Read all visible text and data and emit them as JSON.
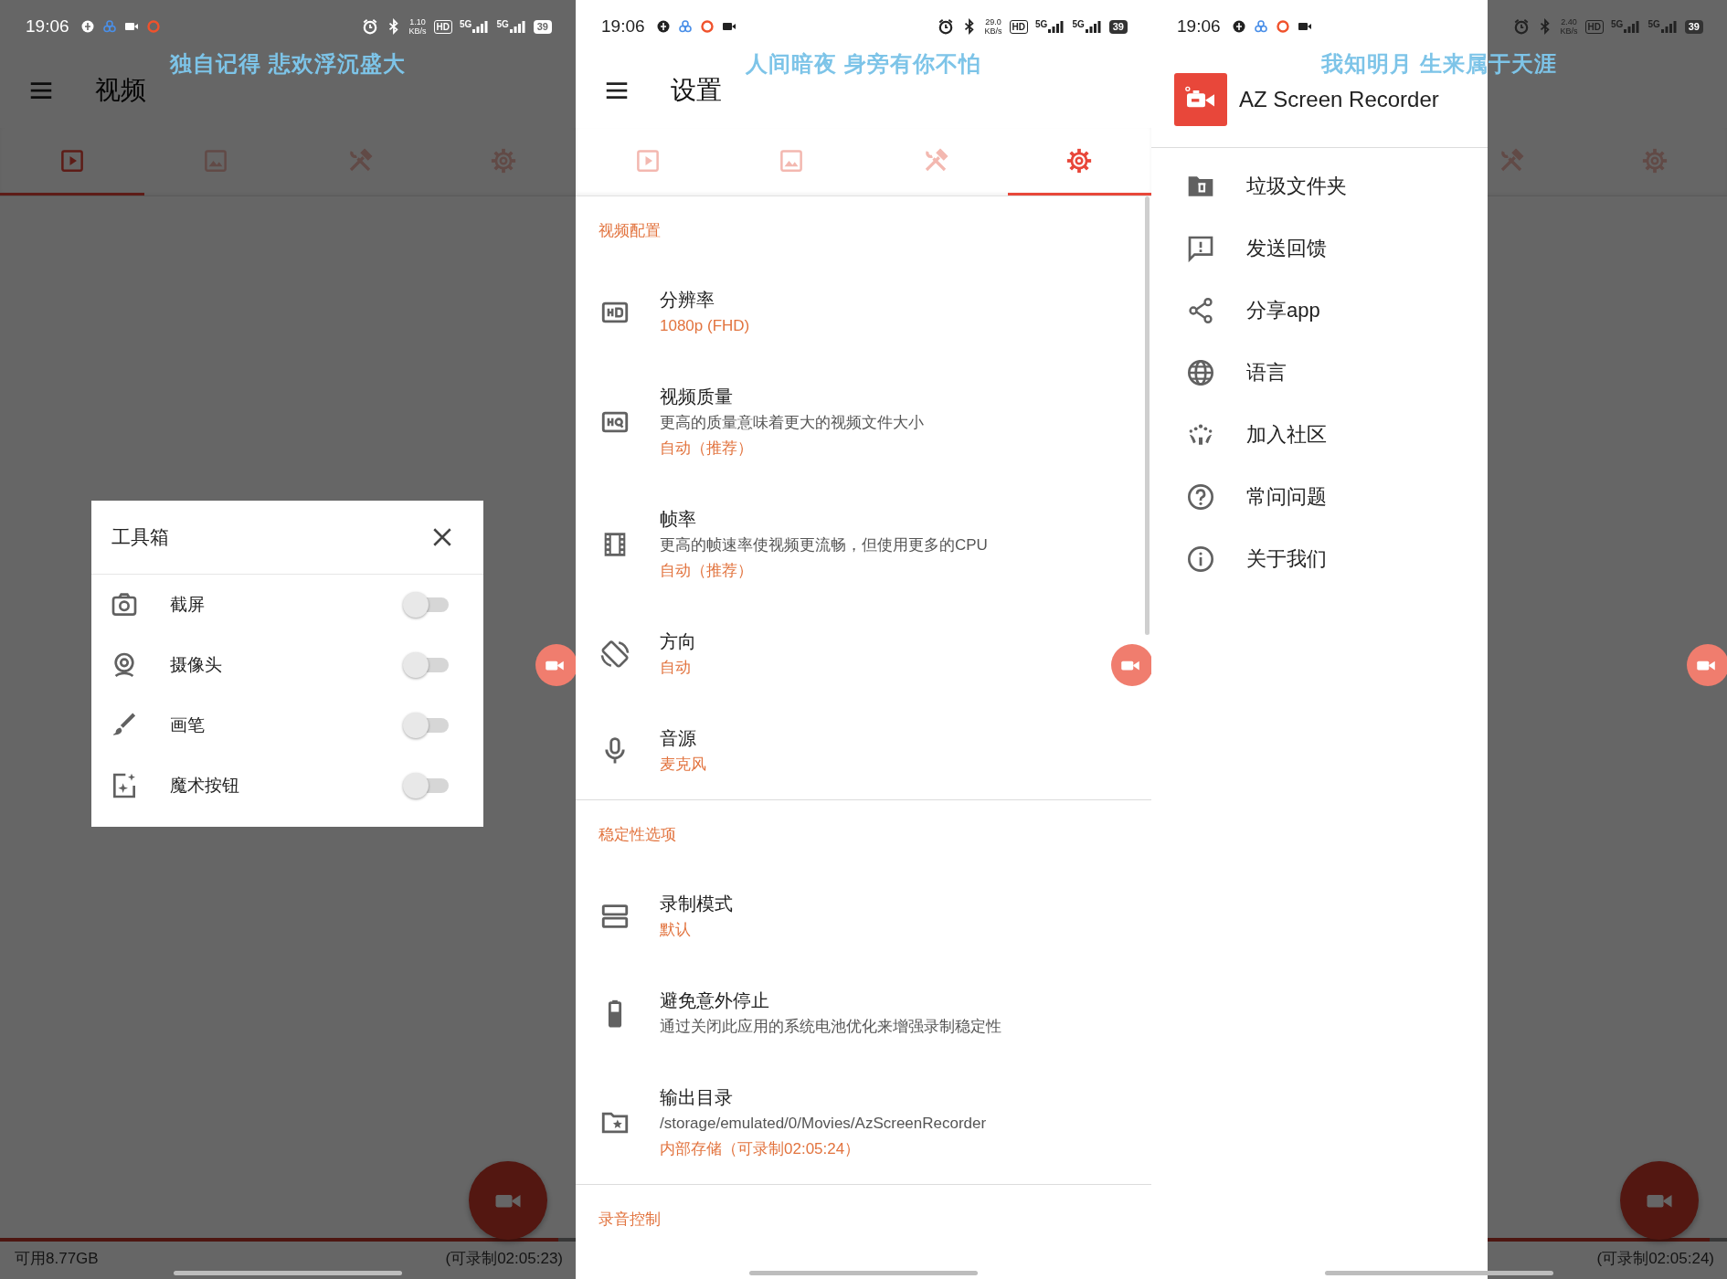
{
  "panels": [
    {
      "status_bar": {
        "time": "19:06",
        "notifications": [
          {
            "kind": "shield"
          },
          {
            "kind": "triad"
          },
          {
            "kind": "video"
          },
          {
            "kind": "record"
          }
        ],
        "speed": "1.10",
        "speed_unit": "KB/s",
        "hd": "HD",
        "networks": [
          "5G",
          "5G"
        ],
        "battery": "39",
        "light": true
      },
      "lyric": "独自记得 悲欢浮沉盛大",
      "dimmed": true,
      "record_button": true,
      "toolbar": {
        "title": "视频"
      },
      "tabs": [
        {
          "kind": "video",
          "selected": true
        },
        {
          "kind": "image",
          "selected": false
        },
        {
          "kind": "tools",
          "selected": false
        },
        {
          "kind": "settings",
          "selected": false
        }
      ],
      "dialog": {
        "title": "工具箱",
        "items": [
          {
            "kind": "camera",
            "label": "截屏",
            "on": false
          },
          {
            "kind": "webcam",
            "label": "摄像头",
            "on": false
          },
          {
            "kind": "brush",
            "label": "画笔",
            "on": false
          },
          {
            "kind": "magic",
            "label": "魔术按钮",
            "on": false
          }
        ]
      },
      "footer": {
        "storage": "可用8.77GB",
        "remaining": "(可录制02:05:23)",
        "level": 0.97
      }
    },
    {
      "status_bar": {
        "time": "19:06",
        "notifications": [
          {
            "kind": "shield"
          },
          {
            "kind": "triad"
          },
          {
            "kind": "record"
          },
          {
            "kind": "video"
          }
        ],
        "speed": "29.0",
        "speed_unit": "KB/s",
        "hd": "HD",
        "networks": [
          "5G",
          "5G"
        ],
        "battery": "39",
        "light": false
      },
      "lyric": "人间暗夜 身旁有你不怕",
      "dimmed": false,
      "toolbar": {
        "title": "设置"
      },
      "tabs": [
        {
          "kind": "video",
          "selected": false
        },
        {
          "kind": "image",
          "selected": false
        },
        {
          "kind": "tools",
          "selected": false
        },
        {
          "kind": "settings",
          "selected": true
        }
      ],
      "settings": [
        {
          "title": "视频配置",
          "items": [
            {
              "kind": "hd",
              "title": "分辨率",
              "value": "1080p (FHD)"
            },
            {
              "kind": "hq",
              "title": "视频质量",
              "summary": "更高的质量意味着更大的视频文件大小",
              "value": "自动（推荐）"
            },
            {
              "kind": "film",
              "title": "帧率",
              "summary": "更高的帧速率使视频更流畅，但使用更多的CPU",
              "value": "自动（推荐）"
            },
            {
              "kind": "rotate",
              "title": "方向",
              "value": "自动"
            },
            {
              "kind": "mic",
              "title": "音源",
              "value": "麦克风"
            }
          ]
        },
        {
          "title": "稳定性选项",
          "items": [
            {
              "kind": "layers",
              "title": "录制模式",
              "value": "默认"
            },
            {
              "kind": "battery",
              "title": "避免意外停止",
              "summary": "通过关闭此应用的系统电池优化来增强录制稳定性"
            },
            {
              "kind": "folder",
              "title": "输出目录",
              "summary": "/storage/emulated/0/Movies/AzScreenRecorder",
              "value": "内部存储（可录制02:05:24）"
            }
          ]
        },
        {
          "title": "录音控制"
        }
      ]
    },
    {
      "status_bar": {
        "time": "19:06",
        "notifications": [
          {
            "kind": "shield"
          },
          {
            "kind": "triad"
          },
          {
            "kind": "record"
          },
          {
            "kind": "video"
          }
        ],
        "speed": "2.40",
        "speed_unit": "KB/s",
        "hd": "HD",
        "networks": [
          "5G",
          "5G"
        ],
        "battery": "39",
        "light": false
      },
      "lyric": "我知明月 生来属于天涯",
      "dimmed": true,
      "record_button": true,
      "tabs": [
        {
          "kind": "tools",
          "selected": false
        },
        {
          "kind": "settings",
          "selected": false
        }
      ],
      "drawer": {
        "app_name": "AZ Screen Recorder",
        "items": [
          {
            "kind": "trash",
            "label": "垃圾文件夹"
          },
          {
            "kind": "feedback",
            "label": "发送回馈"
          },
          {
            "kind": "share",
            "label": "分享app"
          },
          {
            "kind": "globe",
            "label": "语言"
          },
          {
            "kind": "community",
            "label": "加入社区"
          },
          {
            "kind": "help",
            "label": "常问问题"
          },
          {
            "kind": "info",
            "label": "关于我们"
          }
        ]
      },
      "footer": {
        "remaining": "(可录制02:05:24)",
        "level": 0.97
      }
    }
  ]
}
